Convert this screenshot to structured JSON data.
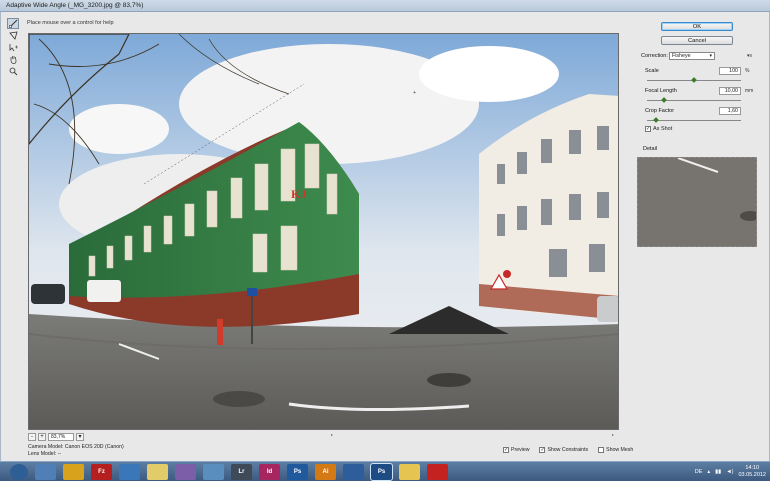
{
  "window": {
    "title": "Adaptive Wide Angle (_MG_3200.jpg @ 83,7%)"
  },
  "hint": "Place mouse over a control for help",
  "toolbar": {
    "icons": [
      "constraint-tool-icon",
      "polygon-constraint-tool-icon",
      "move-tool-icon",
      "hand-tool-icon",
      "zoom-tool-icon"
    ]
  },
  "zoom": {
    "minus": "-",
    "plus": "+",
    "value": "83,7%"
  },
  "camera": {
    "model": "Camera Model: Canon EOS 20D (Canon)",
    "lens": "Lens Model: --"
  },
  "options": [
    {
      "label": "Preview",
      "checked": true
    },
    {
      "label": "Show Constraints",
      "checked": true
    },
    {
      "label": "Show Mesh",
      "checked": false
    }
  ],
  "panel": {
    "ok": "OK",
    "cancel": "Cancel",
    "correction_label": "Correction:",
    "correction_value": "Fisheye",
    "scale": {
      "label": "Scale",
      "value": "100",
      "unit": "%",
      "level": 0.5
    },
    "focal_length": {
      "label": "Focal Length",
      "value": "10,00",
      "unit": "mm",
      "level": 0.18
    },
    "crop_factor": {
      "label": "Crop Factor",
      "value": "1,60",
      "level": 0.1
    },
    "as_shot": {
      "label": "As Shot",
      "checked": true
    },
    "detail_label": "Detail"
  },
  "taskbar": {
    "apps": [
      {
        "name": "start-button-icon",
        "label": "",
        "color": "#2d5f96"
      },
      {
        "name": "explorer-icon",
        "label": "",
        "color": "#4f7fb5"
      },
      {
        "name": "chrome-icon",
        "label": "",
        "color": "#d9a21c"
      },
      {
        "name": "filezilla-icon",
        "label": "Fz",
        "color": "#b51f1f"
      },
      {
        "name": "thunderbird-icon",
        "label": "",
        "color": "#3a77b8"
      },
      {
        "name": "notes-icon",
        "label": "",
        "color": "#e2cc6a"
      },
      {
        "name": "after-effects-icon",
        "label": "",
        "color": "#7b5ea7"
      },
      {
        "name": "image-viewer-icon",
        "label": "",
        "color": "#5a8ebf"
      },
      {
        "name": "lightroom-icon",
        "label": "Lr",
        "color": "#3e4a57"
      },
      {
        "name": "indesign-icon",
        "label": "Id",
        "color": "#a8265f"
      },
      {
        "name": "photoshop-cs-icon",
        "label": "Ps",
        "color": "#215a9c"
      },
      {
        "name": "illustrator-icon",
        "label": "Ai",
        "color": "#d47a14"
      },
      {
        "name": "media-icon",
        "label": "",
        "color": "#2e5d9b"
      },
      {
        "name": "photoshop-active-icon",
        "label": "Ps",
        "color": "#1d4b84"
      },
      {
        "name": "folder-icon",
        "label": "",
        "color": "#e6c452"
      },
      {
        "name": "acrobat-icon",
        "label": "",
        "color": "#c42121"
      }
    ],
    "lang": "DE",
    "time": "14:10",
    "date": "03.05.2012"
  }
}
